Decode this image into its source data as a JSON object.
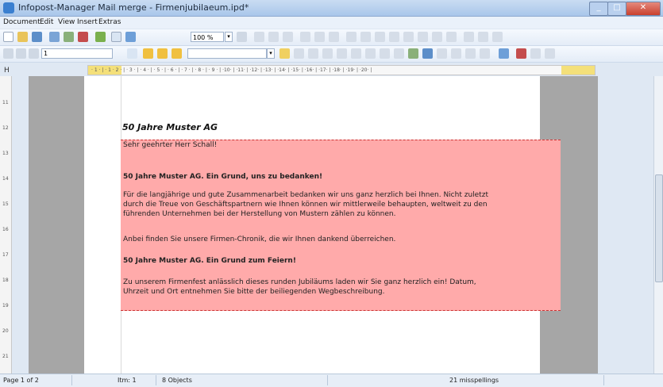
{
  "window": {
    "title": "Infopost-Manager Mail merge - Firmenjubilaeum.ipd*"
  },
  "menu": [
    "Document",
    "Edit",
    "View",
    "Insert",
    "Extras"
  ],
  "toolbar": {
    "zoom_value": "100 %",
    "index_value": "1"
  },
  "ruler": {
    "label": "H",
    "text": "· 1 · | · 1 · 2 · | · 3 · | · 4 · | · 5 · | · 6 · | · 7 · | · 8 · | · 9 · | ·10· | ·11· | ·12· | ·13· | ·14· | ·15· | ·16· | ·17· | ·18· | ·19· | ·20· |"
  },
  "vruler": [
    "11",
    "12",
    "13",
    "14",
    "15",
    "16",
    "17",
    "18",
    "19",
    "20",
    "21"
  ],
  "document": {
    "heading": "50 Jahre Muster AG",
    "lines": [
      "Sehr geehrter Herr Schall!",
      "50 Jahre Muster AG. Ein Grund, uns zu bedanken!",
      "Für die langjährige und gute Zusammenarbeit bedanken wir uns ganz herzlich bei Ihnen. Nicht zuletzt",
      "durch die Treue von Geschäftspartnern wie Ihnen können wir mittlerweile behaupten, weltweit zu den",
      "führenden Unternehmen bei der Herstellung von Mustern zählen zu können.",
      "Anbei finden Sie unsere Firmen-Chronik, die wir Ihnen dankend überreichen.",
      "50 Jahre Muster AG. Ein Grund zum Feiern!",
      "Zu unserem Firmenfest anlässlich dieses runden Jubiläums laden wir Sie ganz herzlich ein! Datum,",
      "Uhrzeit und Ort entnehmen Sie bitte der beiliegenden Wegbeschreibung."
    ]
  },
  "status": {
    "page": "Page 1 of 2",
    "item": "Itm: 1",
    "objects": "8 Objects",
    "misspellings": "21 misspellings"
  },
  "colors": {
    "highlight": "#ffaaaa",
    "border": "#cc3333"
  }
}
